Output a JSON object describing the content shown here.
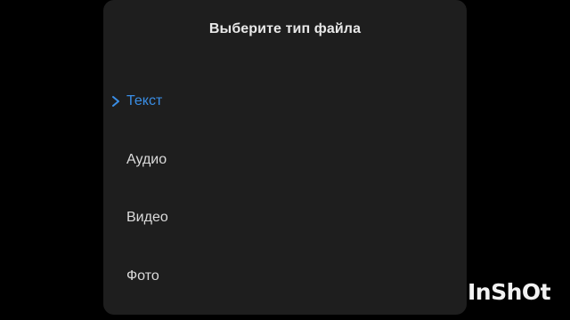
{
  "dialog": {
    "title": "Выберите тип файла",
    "options": [
      {
        "label": "Текст",
        "selected": true
      },
      {
        "label": "Аудио",
        "selected": false
      },
      {
        "label": "Видео",
        "selected": false
      },
      {
        "label": "Фото",
        "selected": false
      }
    ]
  },
  "watermark": {
    "text": "InShOt"
  },
  "colors": {
    "background": "#000000",
    "dialog_background": "#1e1e1e",
    "accent": "#3a8ee6",
    "text": "#dcdcdc"
  },
  "icons": {
    "selected_marker": "chevron-right-icon"
  }
}
